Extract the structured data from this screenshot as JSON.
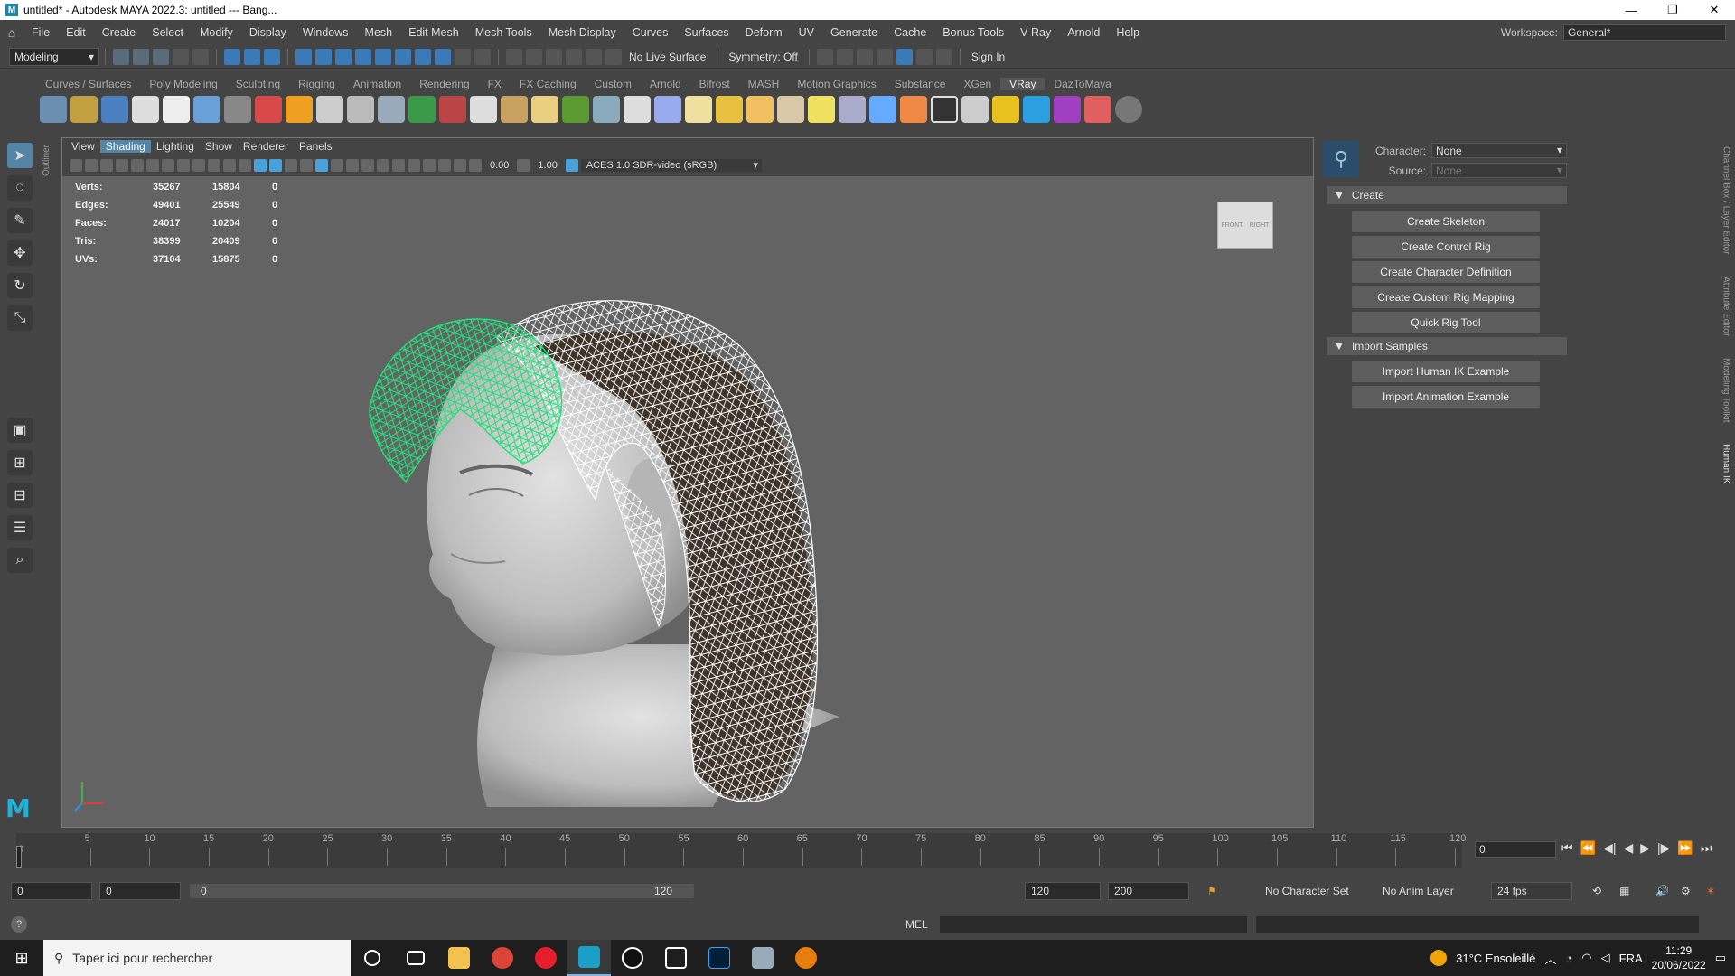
{
  "window": {
    "title": "untitled* - Autodesk MAYA 2022.3: untitled   ---   Bang...",
    "logo": "M"
  },
  "menubar": [
    "File",
    "Edit",
    "Create",
    "Select",
    "Modify",
    "Display",
    "Windows",
    "Mesh",
    "Edit Mesh",
    "Mesh Tools",
    "Mesh Display",
    "Curves",
    "Surfaces",
    "Deform",
    "UV",
    "Generate",
    "Cache",
    "Bonus Tools",
    "V-Ray",
    "Arnold",
    "Help"
  ],
  "workspace": {
    "label": "Workspace:",
    "value": "General*"
  },
  "statusline": {
    "mode": "Modeling",
    "live_surface": "No Live Surface",
    "symmetry": "Symmetry: Off",
    "sign_in": "Sign In"
  },
  "shelf_tabs": [
    "Curves / Surfaces",
    "Poly Modeling",
    "Sculpting",
    "Rigging",
    "Animation",
    "Rendering",
    "FX",
    "FX Caching",
    "Custom",
    "Arnold",
    "Bifrost",
    "MASH",
    "Motion Graphics",
    "Substance",
    "XGen",
    "VRay",
    "DazToMaya"
  ],
  "shelf_active": "VRay",
  "viewport": {
    "menu": [
      "View",
      "Shading",
      "Lighting",
      "Show",
      "Renderer",
      "Panels"
    ],
    "active_menu": "Shading",
    "exposure": "0.00",
    "gamma": "1.00",
    "color_space": "ACES 1.0 SDR-video (sRGB)",
    "hud": [
      {
        "label": "Verts:",
        "a": "35267",
        "b": "15804",
        "c": "0"
      },
      {
        "label": "Edges:",
        "a": "49401",
        "b": "25549",
        "c": "0"
      },
      {
        "label": "Faces:",
        "a": "24017",
        "b": "10204",
        "c": "0"
      },
      {
        "label": "Tris:",
        "a": "38399",
        "b": "20409",
        "c": "0"
      },
      {
        "label": "UVs:",
        "a": "37104",
        "b": "15875",
        "c": "0"
      }
    ],
    "viewcube": {
      "front": "FRONT",
      "right": "RIGHT"
    }
  },
  "outliner_label": "Outliner",
  "human_ik": {
    "character_label": "Character:",
    "character_value": "None",
    "source_label": "Source:",
    "source_value": "None",
    "create_section": "Create",
    "create_buttons": [
      "Create Skeleton",
      "Create Control Rig",
      "Create Character Definition",
      "Create Custom Rig Mapping",
      "Quick Rig Tool"
    ],
    "import_section": "Import Samples",
    "import_buttons": [
      "Import Human IK Example",
      "Import Animation Example"
    ]
  },
  "side_tabs": [
    "Channel Box / Layer Editor",
    "Attribute Editor",
    "Modeling Toolkit",
    "Human IK"
  ],
  "timeline": {
    "ticks": [
      "5",
      "10",
      "15",
      "20",
      "25",
      "30",
      "35",
      "40",
      "45",
      "50",
      "55",
      "60",
      "65",
      "70",
      "75",
      "80",
      "85",
      "90",
      "95",
      "100",
      "105",
      "110",
      "115",
      "120"
    ],
    "start_label": "0",
    "current_frame": "0"
  },
  "range": {
    "start": "0",
    "anim_start": "0",
    "slider_low": "0",
    "slider_high": "120",
    "end": "120",
    "anim_end": "200",
    "char_set": "No Character Set",
    "anim_layer": "No Anim Layer",
    "fps": "24 fps"
  },
  "cmdline": {
    "lang": "MEL"
  },
  "taskbar": {
    "search_placeholder": "Taper ici pour rechercher",
    "weather": "31°C Ensoleillé",
    "lang": "FRA",
    "time": "11:29",
    "date": "20/06/2022"
  },
  "colors": {
    "accent": "#5285a6",
    "selection_green": "#22e07a",
    "wireframe": "#ffffff"
  }
}
